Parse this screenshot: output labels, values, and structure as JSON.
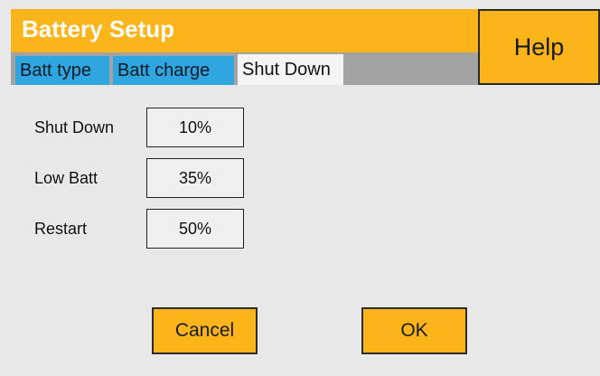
{
  "window": {
    "title": "Battery Setup"
  },
  "help_button": {
    "label": "Help"
  },
  "tabs": [
    {
      "label": "Batt type",
      "active": false
    },
    {
      "label": "Batt charge",
      "active": false
    },
    {
      "label": "Shut Down",
      "active": true
    }
  ],
  "settings": [
    {
      "label": "Shut Down",
      "value": "10%"
    },
    {
      "label": "Low Batt",
      "value": "35%"
    },
    {
      "label": "Restart",
      "value": "50%"
    }
  ],
  "actions": {
    "cancel_label": "Cancel",
    "ok_label": "OK"
  },
  "colors": {
    "accent": "#fbb41a",
    "tab_inactive": "#2fa6df",
    "tab_active": "#f4f4f4",
    "tab_strip": "#a3a3a3",
    "background": "#e8e8e8"
  }
}
